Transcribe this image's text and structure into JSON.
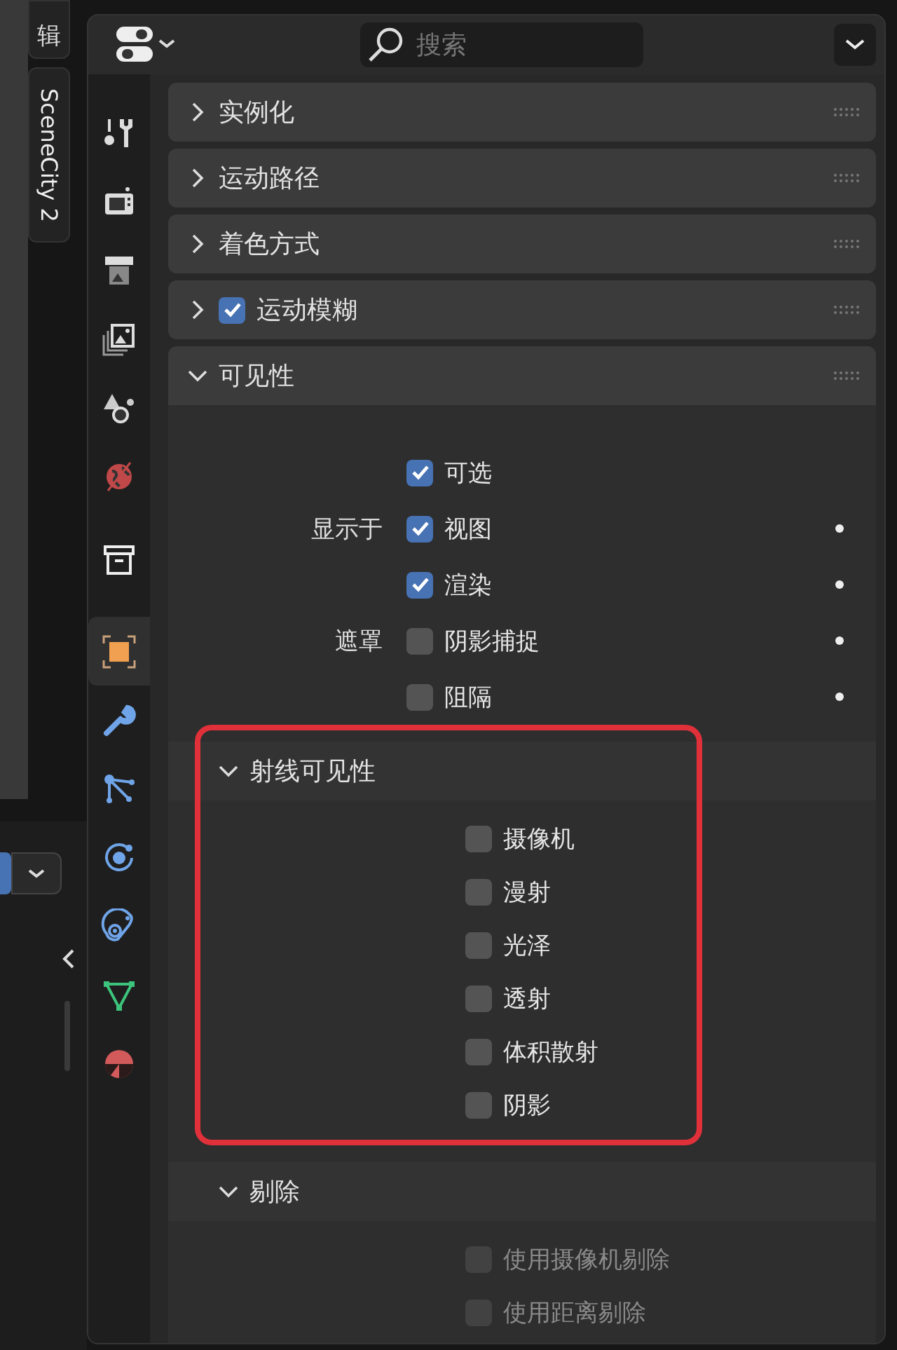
{
  "side_tabs": [
    {
      "label": "辑"
    },
    {
      "label": "SceneCity 2"
    }
  ],
  "header": {
    "search": {
      "placeholder": "搜索"
    }
  },
  "property_tabs": [
    {
      "kind": "tool",
      "selected": false
    },
    {
      "kind": "render",
      "selected": false
    },
    {
      "kind": "output",
      "selected": false
    },
    {
      "kind": "view_layer",
      "selected": false
    },
    {
      "kind": "scene",
      "selected": false
    },
    {
      "kind": "world",
      "selected": false
    },
    {
      "kind": "collection",
      "selected": false
    },
    {
      "kind": "object",
      "selected": true
    },
    {
      "kind": "modifiers",
      "selected": false
    },
    {
      "kind": "particles",
      "selected": false
    },
    {
      "kind": "physics",
      "selected": false
    },
    {
      "kind": "constraints",
      "selected": false
    },
    {
      "kind": "data",
      "selected": false
    },
    {
      "kind": "material",
      "selected": false
    }
  ],
  "panels": [
    {
      "title": "实例化",
      "expanded": false
    },
    {
      "title": "运动路径",
      "expanded": false
    },
    {
      "title": "着色方式",
      "expanded": false
    },
    {
      "title": "运动模糊",
      "expanded": false,
      "checkbox": {
        "checked": true
      }
    },
    {
      "title": "可见性",
      "expanded": true,
      "rows": [
        {
          "option": "可选",
          "checked": true,
          "keyframe": false
        },
        {
          "group": "显示于",
          "option": "视图",
          "checked": true,
          "keyframe": true
        },
        {
          "option": "渲染",
          "checked": true,
          "keyframe": true
        },
        {
          "group": "遮罩",
          "option": "阴影捕捉",
          "checked": false,
          "keyframe": true
        },
        {
          "option": "阻隔",
          "checked": false,
          "keyframe": true
        }
      ],
      "subpanels": [
        {
          "title": "射线可见性",
          "expanded": true,
          "highlighted": true,
          "options": [
            {
              "label": "摄像机",
              "checked": false,
              "disabled": false
            },
            {
              "label": "漫射",
              "checked": false,
              "disabled": false
            },
            {
              "label": "光泽",
              "checked": false,
              "disabled": false
            },
            {
              "label": "透射",
              "checked": false,
              "disabled": false
            },
            {
              "label": "体积散射",
              "checked": false,
              "disabled": false
            },
            {
              "label": "阴影",
              "checked": false,
              "disabled": false
            }
          ]
        },
        {
          "title": "剔除",
          "expanded": true,
          "highlighted": false,
          "options": [
            {
              "label": "使用摄像机剔除",
              "checked": false,
              "disabled": true
            },
            {
              "label": "使用距离剔除",
              "checked": false,
              "disabled": true
            }
          ]
        }
      ]
    }
  ]
}
